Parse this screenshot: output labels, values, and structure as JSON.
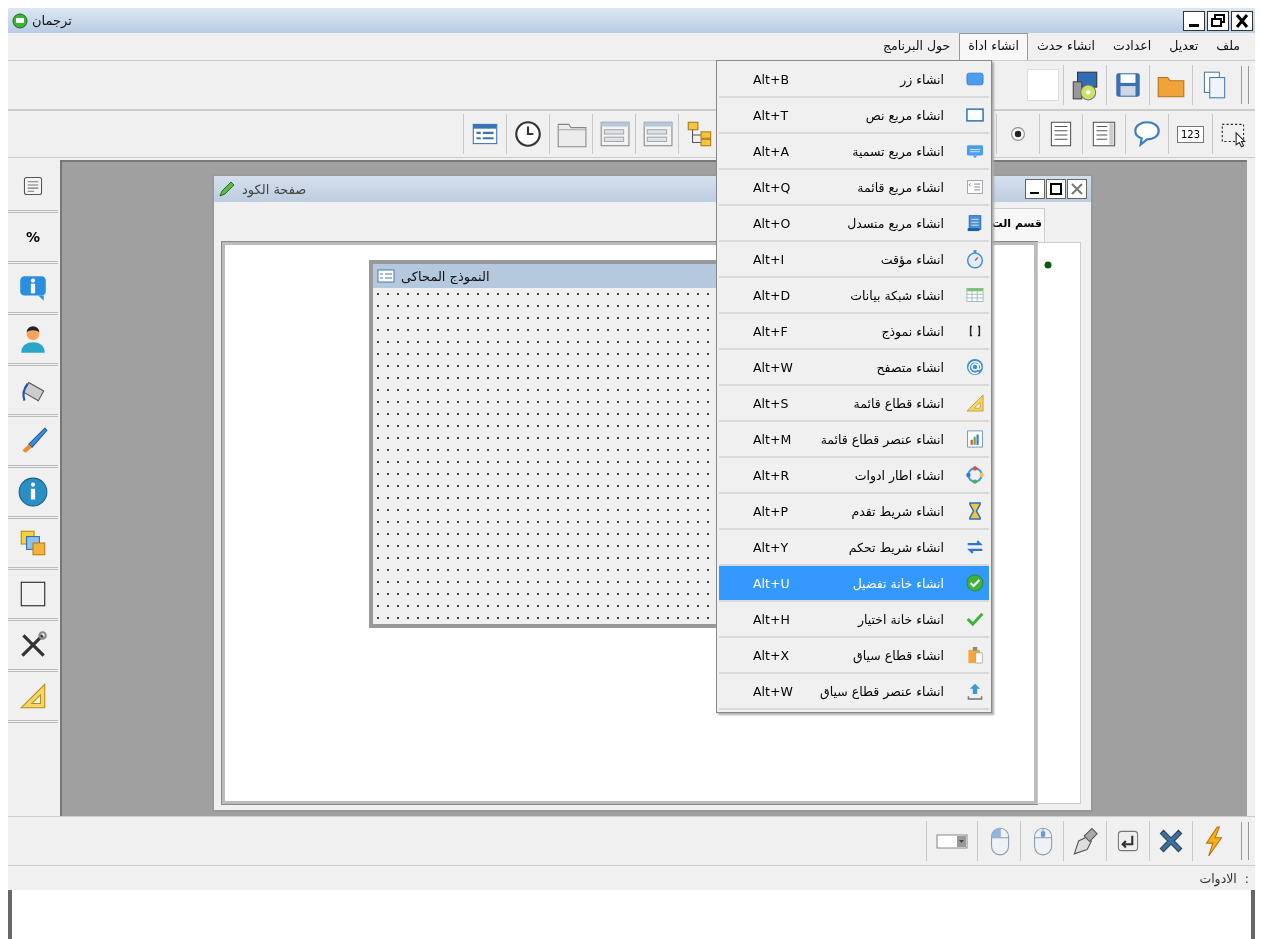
{
  "window": {
    "title": "ترجمان"
  },
  "menu_bar": [
    {
      "label": "ملف",
      "selected": false
    },
    {
      "label": "تعديل",
      "selected": false
    },
    {
      "label": "اعدادت",
      "selected": false
    },
    {
      "label": "انشاء حدث",
      "selected": false
    },
    {
      "label": "انشاء اداة",
      "selected": true
    },
    {
      "label": "حول البرنامج",
      "selected": false
    }
  ],
  "toolbar": {
    "counter_label": "123"
  },
  "side_toolbar": {
    "percent_label": "%"
  },
  "code_page": {
    "title": "صفحة الكود",
    "tab": "قسم الت"
  },
  "simulated_form": {
    "title": "النموذج المحاكى"
  },
  "dropdown": [
    {
      "label": "انشاء زر",
      "shortcut": "Alt+B",
      "selected": false
    },
    {
      "label": "انشاء مربع نص",
      "shortcut": "Alt+T",
      "selected": false
    },
    {
      "label": "انشاء مربع تسمية",
      "shortcut": "Alt+A",
      "selected": false
    },
    {
      "label": "انشاء مربع قائمة",
      "shortcut": "Alt+Q",
      "selected": false
    },
    {
      "label": "انشاء مربع منسدل",
      "shortcut": "Alt+O",
      "selected": false
    },
    {
      "label": "انشاء مؤقت",
      "shortcut": "Alt+I",
      "selected": false
    },
    {
      "label": "انشاء شبكة بيانات",
      "shortcut": "Alt+D",
      "selected": false
    },
    {
      "label": "انشاء نموذج",
      "shortcut": "Alt+F",
      "selected": false
    },
    {
      "label": "انشاء متصفح",
      "shortcut": "Alt+W",
      "selected": false
    },
    {
      "label": "انشاء قطاع قائمة",
      "shortcut": "Alt+S",
      "selected": false
    },
    {
      "label": "انشاء عنصر قطاع قائمة",
      "shortcut": "Alt+M",
      "selected": false
    },
    {
      "label": "انشاء اطار ادوات",
      "shortcut": "Alt+R",
      "selected": false
    },
    {
      "label": "انشاء شريط تقدم",
      "shortcut": "Alt+P",
      "selected": false
    },
    {
      "label": "انشاء شريط تحكم",
      "shortcut": "Alt+Y",
      "selected": false
    },
    {
      "label": "انشاء خانة تفضيل",
      "shortcut": "Alt+U",
      "selected": true
    },
    {
      "label": "انشاء خانة اختيار",
      "shortcut": "Alt+H",
      "selected": false
    },
    {
      "label": "انشاء قطاع سياق",
      "shortcut": "Alt+X",
      "selected": false
    },
    {
      "label": "انشاء عنصر قطاع سياق",
      "shortcut": "Alt+W",
      "selected": false
    }
  ],
  "tools_label": "الادوات  :"
}
